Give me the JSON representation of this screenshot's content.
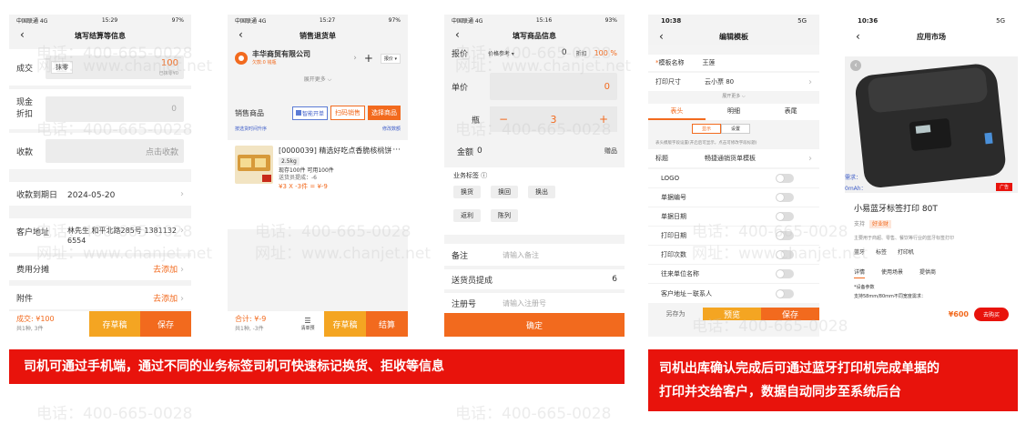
{
  "watermark": {
    "line1": "电话：400-665-0028",
    "line2": "网址：www.chanjet.net"
  },
  "p1": {
    "status_carrier": "中国联通 4G",
    "status_time": "15:29",
    "status_batt": "97%",
    "title": "填写结算等信息",
    "jiaoyi_label": "成交",
    "moling": "抹零",
    "jiaoyi_value": "100",
    "jiaoyi_sub": "已抹零¥0",
    "xianjin_label1": "现金",
    "xianjin_label2": "折扣",
    "xianjin_value": "0",
    "shoukuan_label": "收款",
    "shoukuan_btn": "点击收款",
    "date_label": "收款到期日",
    "date_value": "2024-05-20",
    "addr_label": "客户地址",
    "addr_value": "林先生 和平北路285号 13811326554",
    "fee_label": "费用分摊",
    "fee_action": "去添加",
    "attach_label": "附件",
    "attach_action": "去添加",
    "foot_total": "成交: ¥100",
    "foot_sub": "共1种, 3件",
    "btn_draft": "存草稿",
    "btn_save": "保存"
  },
  "p2": {
    "status_carrier": "中国联通 4G",
    "status_time": "15:27",
    "status_batt": "97%",
    "title": "销售退货单",
    "company": "丰华商贸有限公司",
    "company_sub": "欠款:0  钱瓶",
    "more": "展开更多",
    "section_label": "销售商品",
    "btn_smart": "智能开单",
    "btn_scan": "扫码销售",
    "btn_select": "选择商品",
    "sort_left": "按选货时间升序",
    "sort_right": "修改数额",
    "product_name": "[0000039] 精选好吃点香脆核桃饼",
    "product_spec": "2.5kg",
    "stock": "现存100件    可用100件",
    "delivery": "送货员提成：-6",
    "price": "¥3 X -3件 = ¥-9",
    "foot_total": "合计: ¥-9",
    "foot_sub": "共1种, -3件",
    "clear": "清单预",
    "btn_draft": "存草稿",
    "btn_settle": "结算"
  },
  "p3": {
    "status_carrier": "中国联通 4G",
    "status_time": "15:16",
    "status_batt": "93%",
    "title": "填写商品信息",
    "baojia": "报价",
    "price_ref": "价格参考",
    "baojia_val": "0",
    "zhekou": "折扣",
    "zhekou_val": "100 %",
    "danjia": "单价",
    "danjia_val": "0",
    "ping": "瓶",
    "minus": "−",
    "qty": "3",
    "plus": "+",
    "jine": "金额",
    "jine_val": "0",
    "zengpin": "赠品",
    "biz_tag": "业务标签",
    "tags": [
      "换货",
      "换回",
      "换出",
      "返利",
      "陈列"
    ],
    "beizhu": "备注",
    "beizhu_ph": "请输入备注",
    "tiche": "送货员提成",
    "tiche_val": "6",
    "zhuce": "注册号",
    "zhuce_ph": "请输入注册号",
    "confirm": "确定"
  },
  "p4": {
    "status_time": "10:38",
    "status_net": "5G",
    "title": "编辑模板",
    "name_label": "模板名称",
    "name_value": "王莲",
    "size_label": "打印尺寸",
    "size_value": "云小票 80",
    "more": "展开更多",
    "tabs": [
      "表头",
      "明细",
      "表尾"
    ],
    "sub_show": "显示",
    "sub_set": "设置",
    "hint": "表头模版字段设置(开启后可显示，点击可修改字段标题)",
    "title_label": "标题",
    "title_value": "畅捷通销货单模板",
    "rows": [
      "LOGO",
      "单据编号",
      "单据日期",
      "打印日期",
      "打印次数",
      "往来单位名称",
      "客户地址－联系人"
    ],
    "save_as": "另存为",
    "preview": "预览",
    "save": "保存"
  },
  "p5": {
    "status_time": "10:36",
    "status_net": "5G",
    "title": "应用市场",
    "ad_badge": "广告",
    "left_text1": "需求：",
    "left_text2": "0mAh：",
    "product_title": "小易蓝牙标签打印 80T",
    "support": "支持",
    "support_tag": "好业财",
    "desc": "主要用于商超、零售、餐饮等行业的蓝牙标签打印",
    "features": [
      "蓝牙",
      "标签",
      "打印机"
    ],
    "tabs": [
      "详情",
      "使用场景",
      "提供商"
    ],
    "param_title": "*设备参数",
    "param_line": "支持58mm/80mm不同宽度需求：",
    "price": "¥600",
    "buy": "去购买"
  },
  "banner1": "司机可通过手机端，通过不同的业务标签司机可快速标记换货、拒收等信息",
  "banner2_line1": "司机出库确认完成后可通过蓝牙打印机完成单据的",
  "banner2_line2": "打印并交给客户，数据自动同步至系统后台"
}
